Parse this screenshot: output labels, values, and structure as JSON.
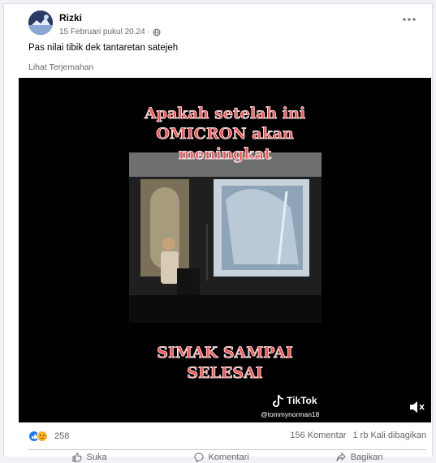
{
  "post": {
    "author": "Rizki",
    "timestamp": "15 Februari pukul 20.24",
    "privacy_icon": "globe-icon",
    "text": "Pas nilai tibik dek tantaretan satejeh",
    "see_translation": "Lihat Terjemahan"
  },
  "video": {
    "caption_top": [
      "Apakah setelah ini",
      "OMICRON akan",
      "meningkat"
    ],
    "caption_bottom": [
      "SIMAK SAMPAI",
      "SELESAI"
    ],
    "watermark_brand": "TikTok",
    "watermark_user": "@tommynorman18",
    "caption_color": "#ff4d4d"
  },
  "stats": {
    "reaction_count": "258",
    "comments": "156 Komentar",
    "shares": "1 rb Kali dibagikan",
    "like_color": "#1877f2",
    "sad_color": "#f7b125"
  },
  "actions": {
    "like": "Suka",
    "comment": "Komentari",
    "share": "Bagikan"
  }
}
